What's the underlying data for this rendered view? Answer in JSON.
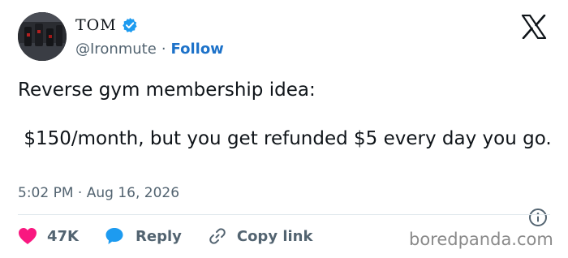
{
  "author": {
    "display_name": "TOM",
    "handle": "@Ironmute",
    "separator": "·",
    "follow_label": "Follow",
    "verified": true,
    "avatar_icon": "avatar-dumbbells"
  },
  "tweet": {
    "line1": "Reverse gym membership idea:",
    "line2": " $150/month, but you get refunded $5 every day you go."
  },
  "meta": {
    "time": "5:02 PM",
    "separator": "·",
    "date": "Aug 16, 2026"
  },
  "actions": {
    "likes_count": "47K",
    "reply_label": "Reply",
    "copy_link_label": "Copy link"
  },
  "watermark": "boredpanda.com",
  "colors": {
    "like": "#f91880",
    "reply": "#1d9bf0",
    "verified": "#1d9bf0",
    "follow": "#1d72c9",
    "muted": "#536471"
  }
}
